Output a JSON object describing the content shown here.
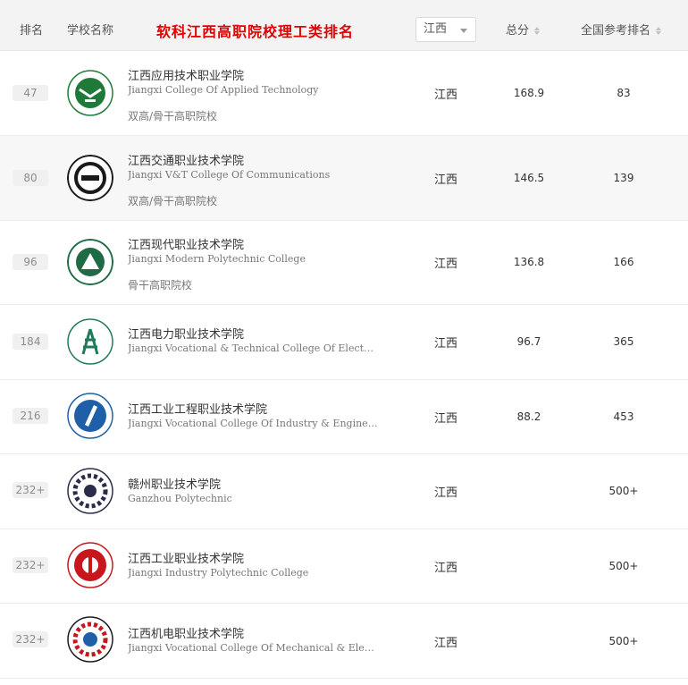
{
  "header": {
    "rank_label": "排名",
    "school_label": "学校名称",
    "title": "软科江西高职院校理工类排名",
    "province_select": "江西",
    "score_label": "总分",
    "national_label": "全国参考排名"
  },
  "rows": [
    {
      "rank": "47",
      "name_cn": "江西应用技术职业学院",
      "name_en": "Jiangxi College Of Applied Technology",
      "tags": "双高/骨干高职院校",
      "province": "江西",
      "score": "168.9",
      "national": "83"
    },
    {
      "rank": "80",
      "name_cn": "江西交通职业技术学院",
      "name_en": "Jiangxi V&T College Of Communications",
      "tags": "双高/骨干高职院校",
      "province": "江西",
      "score": "146.5",
      "national": "139"
    },
    {
      "rank": "96",
      "name_cn": "江西现代职业技术学院",
      "name_en": "Jiangxi Modern Polytechnic College",
      "tags": "骨干高职院校",
      "province": "江西",
      "score": "136.8",
      "national": "166"
    },
    {
      "rank": "184",
      "name_cn": "江西电力职业技术学院",
      "name_en": "Jiangxi Vocational & Technical College Of Electricity",
      "tags": "",
      "province": "江西",
      "score": "96.7",
      "national": "365"
    },
    {
      "rank": "216",
      "name_cn": "江西工业工程职业技术学院",
      "name_en": "Jiangxi Vocational College Of Industry & Engineering",
      "tags": "",
      "province": "江西",
      "score": "88.2",
      "national": "453"
    },
    {
      "rank": "232+",
      "name_cn": "赣州职业技术学院",
      "name_en": "Ganzhou Polytechnic",
      "tags": "",
      "province": "江西",
      "score": "",
      "national": "500+"
    },
    {
      "rank": "232+",
      "name_cn": "江西工业职业技术学院",
      "name_en": "Jiangxi Industry Polytechnic College",
      "tags": "",
      "province": "江西",
      "score": "",
      "national": "500+"
    },
    {
      "rank": "232+",
      "name_cn": "江西机电职业技术学院",
      "name_en": "Jiangxi Vocational College Of Mechanical & Electr…",
      "tags": "",
      "province": "江西",
      "score": "",
      "national": "500+"
    }
  ],
  "colors": {
    "title": "#e10000",
    "header_bg": "#f3f3f3",
    "alt_row_bg": "#f7f7f7"
  },
  "icons": [
    "school-logo-icon",
    "sort-icon",
    "chevron-down-icon"
  ]
}
